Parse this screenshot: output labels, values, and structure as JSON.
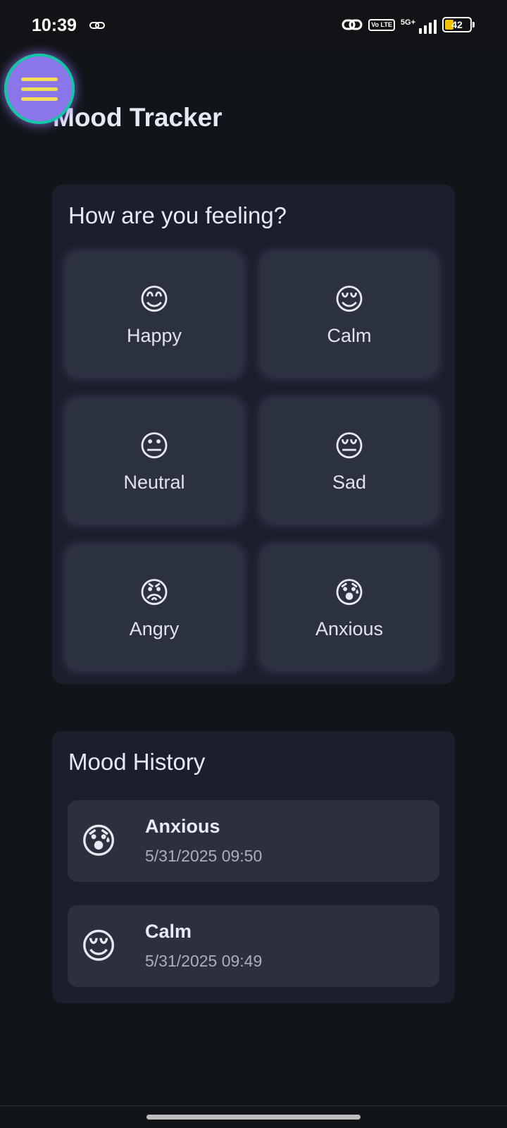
{
  "status_bar": {
    "time": "10:39",
    "volte_label": "Vo LTE",
    "network_label": "5G+",
    "battery_level": "42"
  },
  "header": {
    "title": "Mood Tracker",
    "menu_icon": "hamburger-menu-icon"
  },
  "mood_picker": {
    "title": "How are you feeling?",
    "options": [
      {
        "emoji": "😊",
        "label": "Happy"
      },
      {
        "emoji": "😌",
        "label": "Calm"
      },
      {
        "emoji": "😐",
        "label": "Neutral"
      },
      {
        "emoji": "😔",
        "label": "Sad"
      },
      {
        "emoji": "😡",
        "label": "Angry"
      },
      {
        "emoji": "😰",
        "label": "Anxious"
      }
    ]
  },
  "history": {
    "title": "Mood History",
    "entries": [
      {
        "emoji": "😰",
        "mood": "Anxious",
        "timestamp": "5/31/2025 09:50"
      },
      {
        "emoji": "😌",
        "mood": "Calm",
        "timestamp": "5/31/2025 09:49"
      }
    ]
  },
  "colors": {
    "background": "#111419",
    "card": "#1b1f2b",
    "tile": "#2c313e",
    "menu_button": "#8a76e8",
    "menu_ring": "#15c6a6",
    "menu_lines": "#f3dd57"
  }
}
